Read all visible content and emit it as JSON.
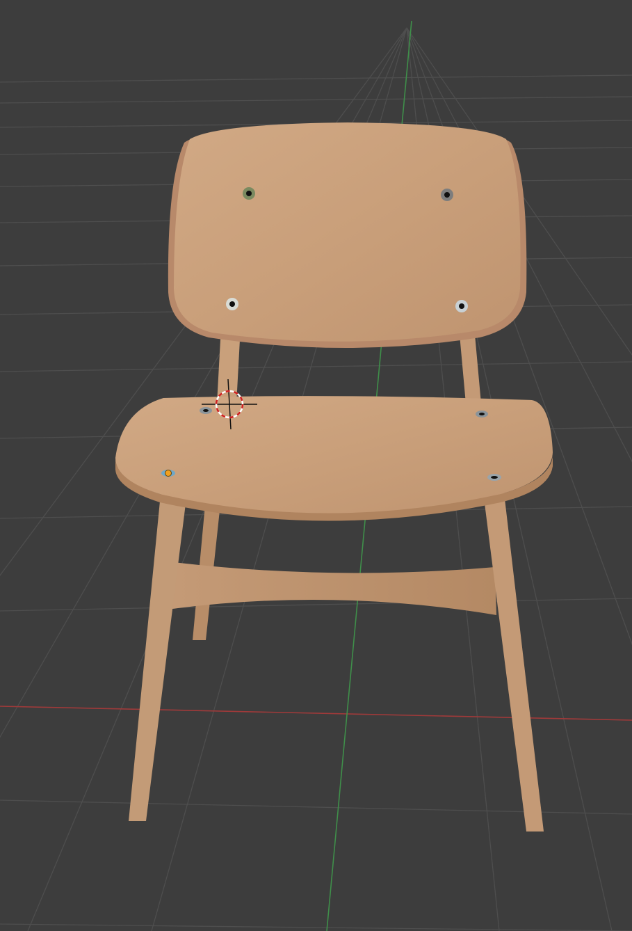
{
  "viewport": {
    "background": "#3d3d3d",
    "grid_color": "#4d4d4d",
    "x_axis_color": "#a03a3a",
    "y_axis_color": "#3f8f4a"
  },
  "object": {
    "name": "chair",
    "wood_color": "#c9a07b",
    "wood_shade": "#b88d68"
  },
  "cursor": {
    "icon": "3d-cursor-icon"
  },
  "origin": {
    "icon": "object-origin-icon",
    "color": "#f0a020"
  }
}
